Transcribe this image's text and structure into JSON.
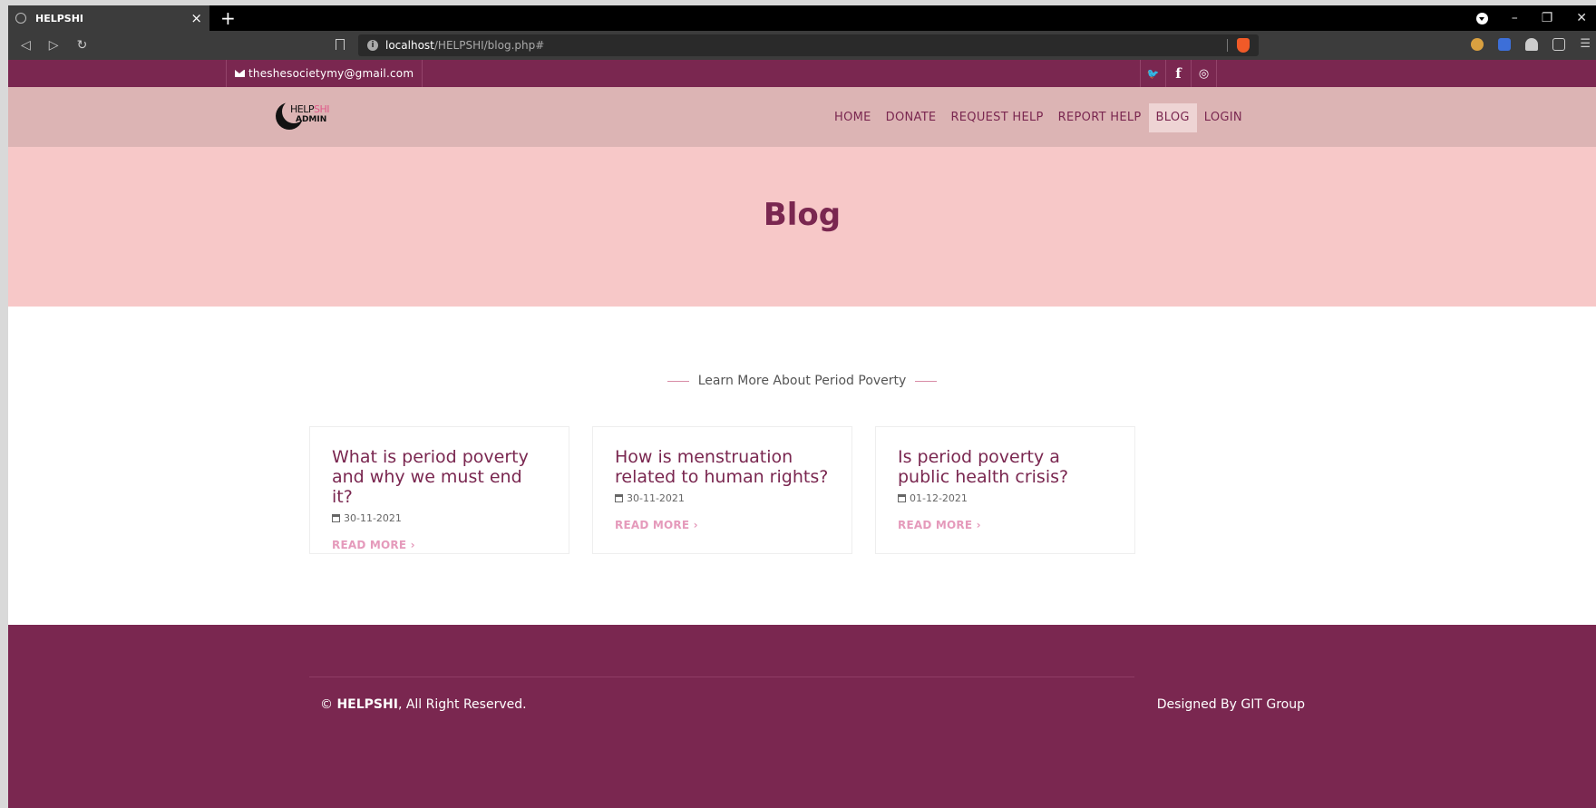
{
  "browser": {
    "tab_title": "HELPSHI",
    "tab_close": "×",
    "new_tab": "+",
    "url_host": "localhost",
    "url_path": "/HELPSHI/blog.php#",
    "nav_back": "◁",
    "nav_forward": "▷",
    "nav_reload": "↻",
    "win_min": "–",
    "win_max": "❐",
    "win_close": "✕",
    "menu_glyph": "☰"
  },
  "topbar": {
    "email": "theshesocietymy@gmail.com",
    "social": [
      "twitter-icon",
      "facebook-icon",
      "instagram-icon"
    ],
    "twitter_glyph": "🐦",
    "facebook_glyph": "f",
    "instagram_glyph": "◎"
  },
  "logo": {
    "line1_a": "HELP",
    "line1_b": "SHI",
    "line2": "ADMIN"
  },
  "nav": {
    "home": "HOME",
    "donate": "DONATE",
    "request_help": "REQUEST HELP",
    "report_help": "REPORT HELP",
    "blog": "BLOG",
    "login": "LOGIN"
  },
  "hero": {
    "title": "Blog"
  },
  "section": {
    "subtitle": "Learn More About Period Poverty"
  },
  "posts": [
    {
      "title": "What is period poverty and why we must end it?",
      "date": "30-11-2021",
      "more": "READ MORE ›"
    },
    {
      "title": "How is menstruation related to human rights?",
      "date": "30-11-2021",
      "more": "READ MORE ›"
    },
    {
      "title": "Is period poverty a public health crisis?",
      "date": "01-12-2021",
      "more": "READ MORE ›"
    }
  ],
  "footer": {
    "copyright_symbol": "©",
    "brand": "HELPSHI",
    "rights": ", All Right Reserved.",
    "designed": "Designed By GIT Group"
  },
  "colors": {
    "primary": "#7a2750",
    "header_bg": "#dcb4b4",
    "hero_bg": "#f7c8c8",
    "link_pink": "#e59abb"
  }
}
